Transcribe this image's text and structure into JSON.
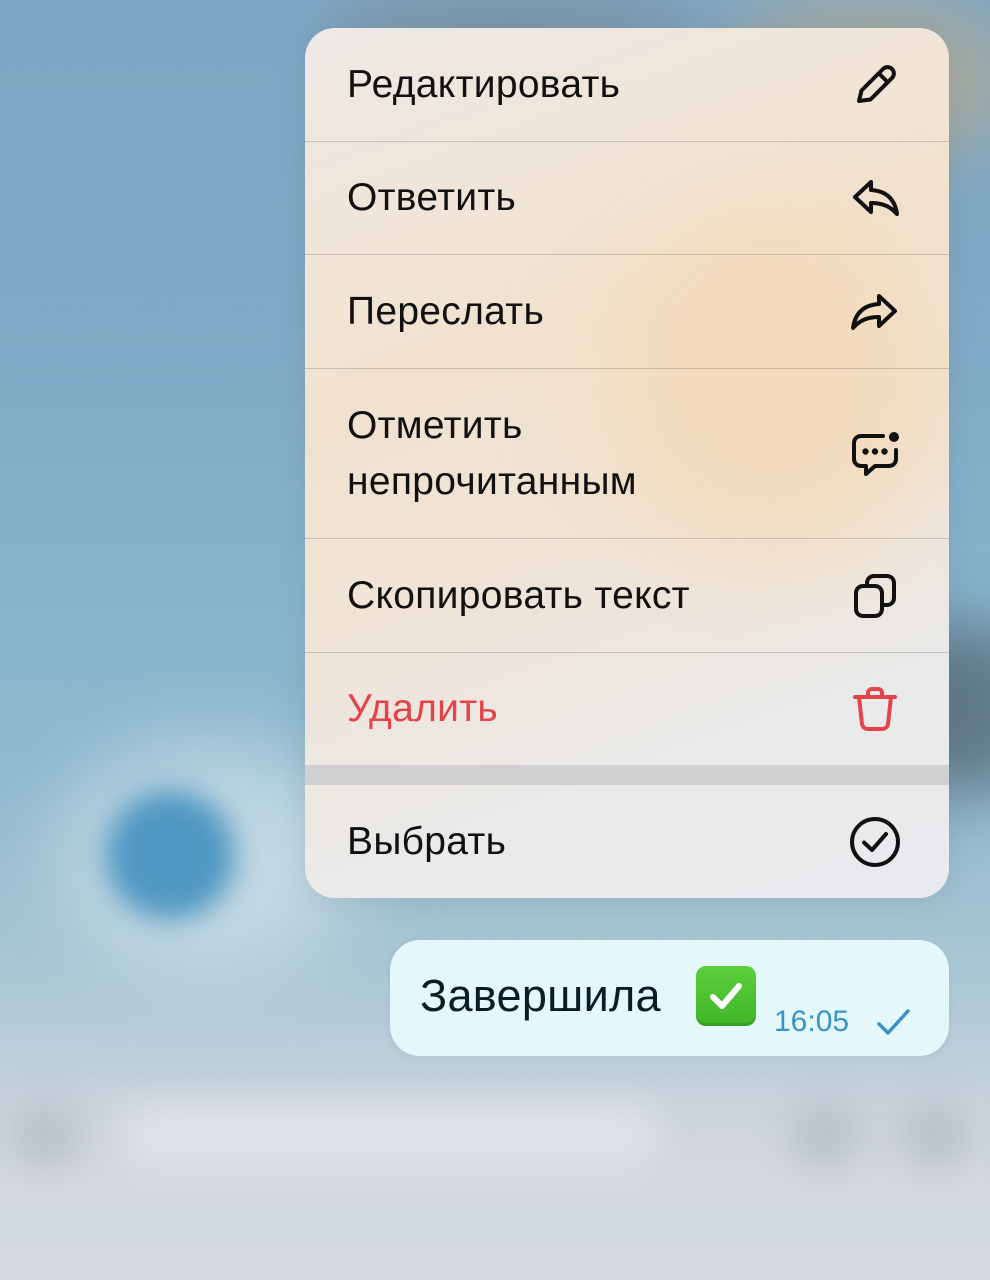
{
  "menu": {
    "items": [
      {
        "label": "Редактировать",
        "icon": "pencil-icon"
      },
      {
        "label": "Ответить",
        "icon": "reply-arrow-icon"
      },
      {
        "label": "Переслать",
        "icon": "forward-arrow-icon"
      },
      {
        "label_line1": "Отметить",
        "label_line2": "непрочитанным",
        "icon": "unread-chat-bubble-icon"
      },
      {
        "label": "Скопировать текст",
        "icon": "copy-icon"
      },
      {
        "label": "Удалить",
        "icon": "trash-icon",
        "color": "#e5434a"
      },
      {
        "label": "Выбрать",
        "icon": "check-circle-icon"
      }
    ]
  },
  "message": {
    "text": "Завершила",
    "emoji": "check-mark-button-emoji",
    "time": "16:05",
    "status_icon": "single-check-icon",
    "bubble_color": "#e4f8fb",
    "time_color": "#3a93c6"
  }
}
